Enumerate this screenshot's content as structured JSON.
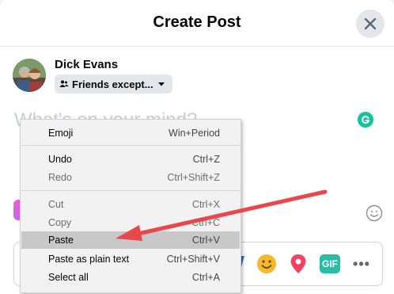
{
  "dialog": {
    "title": "Create Post"
  },
  "user": {
    "name": "Dick Evans",
    "audience": "Friends except..."
  },
  "composer": {
    "placeholder": "What's on your mind?"
  },
  "context_menu": {
    "items": [
      {
        "label": "Emoji",
        "shortcut": "Win+Period",
        "disabled": false
      },
      {
        "label": "Undo",
        "shortcut": "Ctrl+Z",
        "disabled": false
      },
      {
        "label": "Redo",
        "shortcut": "Ctrl+Shift+Z",
        "disabled": true
      },
      {
        "label": "Cut",
        "shortcut": "Ctrl+X",
        "disabled": true
      },
      {
        "label": "Copy",
        "shortcut": "Ctrl+C",
        "disabled": true
      },
      {
        "label": "Paste",
        "shortcut": "Ctrl+V",
        "disabled": false,
        "highlighted": true
      },
      {
        "label": "Paste as plain text",
        "shortcut": "Ctrl+Shift+V",
        "disabled": false
      },
      {
        "label": "Select all",
        "shortcut": "Ctrl+A",
        "disabled": false
      }
    ]
  },
  "toolbar": {
    "gif_label": "GIF",
    "more_label": "•••"
  },
  "colors": {
    "arrow": "#e8474c",
    "grammarly": "#15c39a",
    "gif": "#2abba7",
    "location": "#f3425f",
    "feeling": "#f7b928"
  }
}
